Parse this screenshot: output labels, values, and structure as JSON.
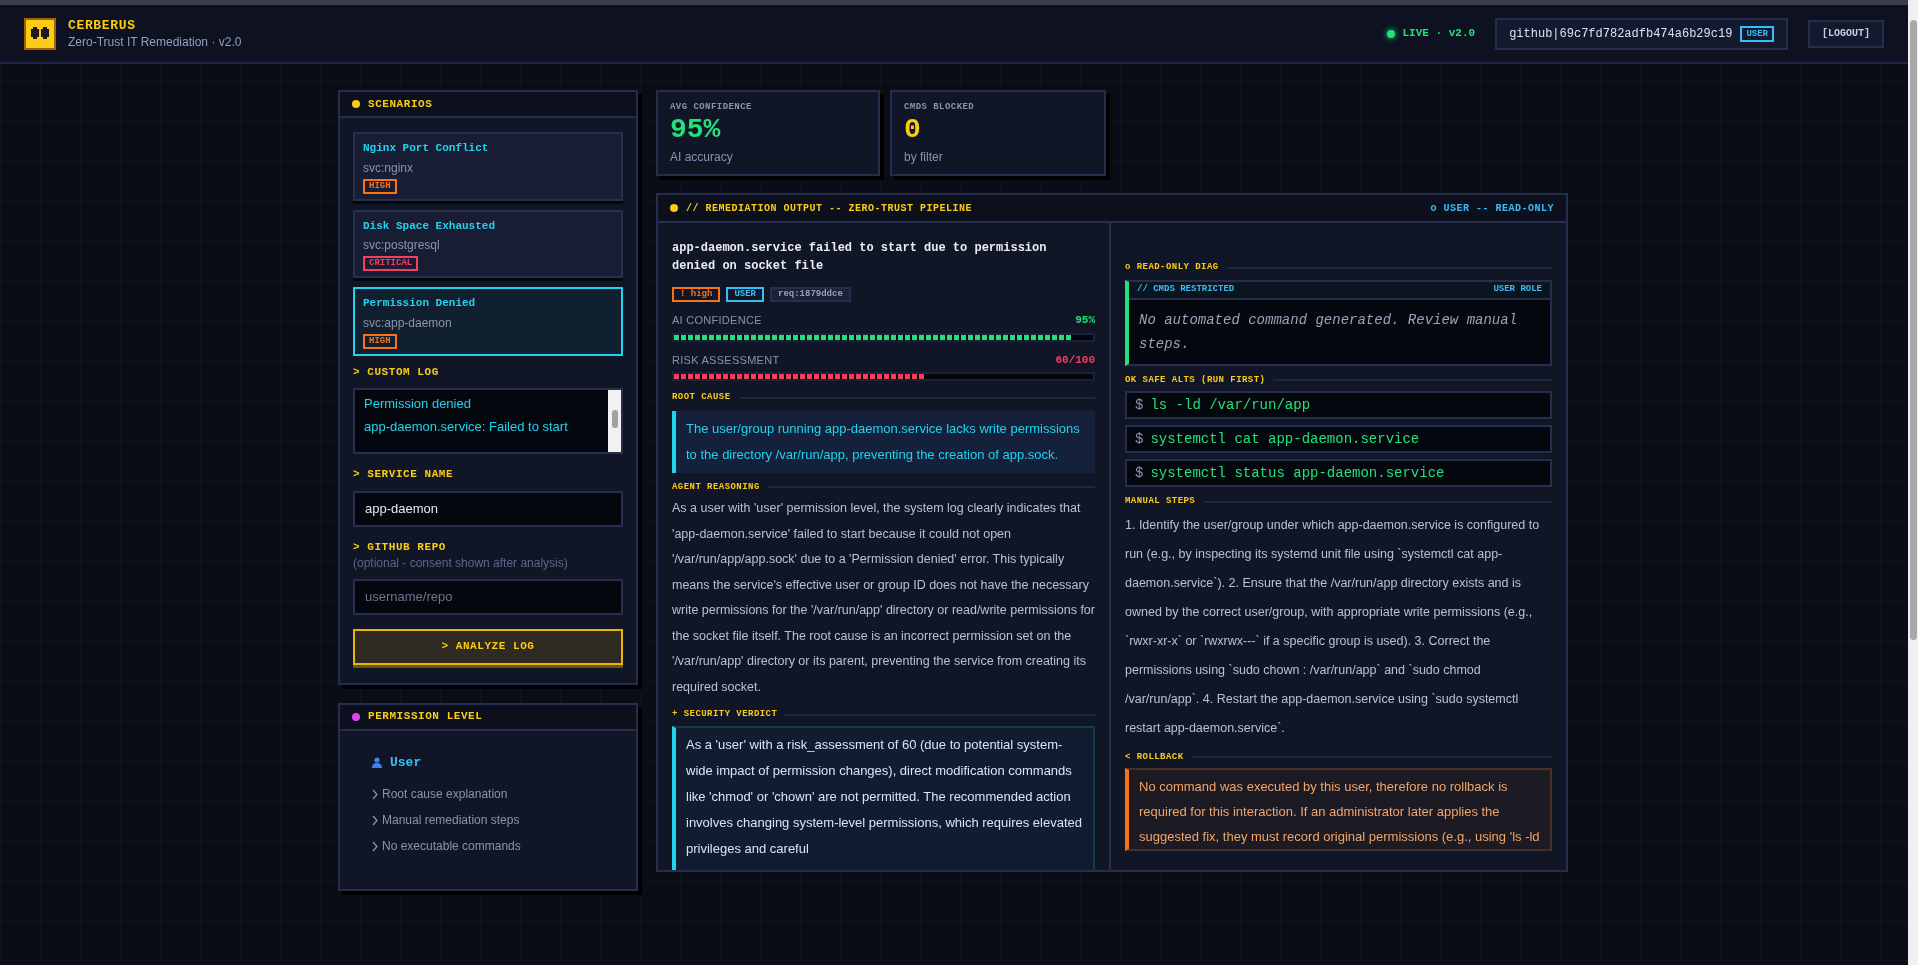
{
  "header": {
    "title": "CERBERUS",
    "subtitle": "Zero-Trust IT Remediation · v2.0",
    "status": {
      "label": "LIVE · v2.0",
      "live": true
    },
    "user": {
      "id": "github|69c7fd782adfb474a6b29c19",
      "role": "USER"
    },
    "logout": "[LOGOUT]"
  },
  "scenarios": {
    "title": "SCENARIOS",
    "items": [
      {
        "title": "Nginx Port Conflict",
        "service": "svc:nginx",
        "severity": "HIGH",
        "color": "#f97316",
        "selected": false
      },
      {
        "title": "Disk Space Exhausted",
        "service": "svc:postgresql",
        "severity": "CRITICAL",
        "color": "#f43f5e",
        "selected": false
      },
      {
        "title": "Permission Denied",
        "service": "svc:app-daemon",
        "severity": "HIGH",
        "color": "#f97316",
        "selected": true
      }
    ]
  },
  "custom_log": {
    "label": "> CUSTOM LOG",
    "lines": [
      "Permission denied",
      "app-daemon.service: Failed to start"
    ]
  },
  "service_name": {
    "label": "> SERVICE NAME",
    "value": "app-daemon"
  },
  "github_repo": {
    "label": "> GITHUB REPO",
    "hint": "(optional - consent shown after analysis)",
    "placeholder": "username/repo"
  },
  "analyze_button": "> ANALYZE LOG",
  "permission_level": {
    "title": "PERMISSION LEVEL",
    "role": "User",
    "items": [
      "Root cause explanation",
      "Manual remediation steps",
      "No executable commands"
    ]
  },
  "stats": [
    {
      "label": "AVG CONFIDENCE",
      "value": "95%",
      "caption": "AI accuracy",
      "color": "#22e07a"
    },
    {
      "label": "CMDS BLOCKED",
      "value": "0",
      "caption": "by filter",
      "color": "#facc15"
    }
  ],
  "remediation": {
    "title": "// REMEDIATION OUTPUT -- ZERO-TRUST PIPELINE",
    "mode": "o USER -- READ-ONLY",
    "summary": "app-daemon.service failed to start due to permission denied on socket file",
    "tags": [
      {
        "text": "! high",
        "color": "#f97316"
      },
      {
        "text": "USER",
        "color": "#38bdf8"
      },
      {
        "text": "req:1879ddce",
        "color": "#94a3b8"
      }
    ],
    "meters": [
      {
        "label": "AI CONFIDENCE",
        "reading": "95%",
        "level": 0.95,
        "color": "#22e07a"
      },
      {
        "label": "RISK ASSESSMENT",
        "reading": "60/100",
        "level": 0.6,
        "color": "#f43f5e"
      }
    ],
    "root_cause": {
      "label": "ROOT CAUSE",
      "text": "The user/group running app-daemon.service lacks write permissions to the directory /var/run/app, preventing the creation of app.sock."
    },
    "reasoning": {
      "label": "AGENT REASONING",
      "text": "As a user with 'user' permission level, the system log clearly indicates that 'app-daemon.service' failed to start because it could not open '/var/run/app/app.sock' due to a 'Permission denied' error. This typically means the service's effective user or group ID does not have the necessary write permissions for the '/var/run/app' directory or read/write permissions for the socket file itself. The root cause is an incorrect permission set on the '/var/run/app' directory or its parent, preventing the service from creating its required socket."
    },
    "verdict": {
      "label": "+ SECURITY VERDICT",
      "text": "As a 'user' with a risk_assessment of 60 (due to potential system-wide impact of permission changes), direct modification commands like 'chmod' or 'chown' are not permitted. The recommended action involves changing system-level permissions, which requires elevated privileges and careful"
    },
    "diag": {
      "label": "o READ-ONLY DIAG",
      "header": "// CMDS RESTRICTED",
      "role": "USER ROLE",
      "message": "No automated command generated. Review manual steps."
    },
    "safe_alts": {
      "label": "OK SAFE ALTS (RUN FIRST)",
      "commands": [
        {
          "prompt": "$",
          "command": "ls -ld /var/run/app"
        },
        {
          "prompt": "$",
          "command": "systemctl cat app-daemon.service"
        },
        {
          "prompt": "$",
          "command": "systemctl status app-daemon.service"
        }
      ]
    },
    "manual_steps": {
      "label": "MANUAL STEPS",
      "text": "1. Identify the user/group under which app-daemon.service is configured to run (e.g., by inspecting its systemd unit file using `systemctl cat app-daemon.service`). 2. Ensure that the /var/run/app directory exists and is owned by the correct user/group, with appropriate write permissions (e.g., `rwxr-xr-x` or `rwxrwx---` if a specific group is used). 3. Correct the permissions using `sudo chown : /var/run/app` and `sudo chmod /var/run/app`. 4. Restart the app-daemon.service using `sudo systemctl restart app-daemon.service`."
    },
    "rollback": {
      "label": "< ROLLBACK",
      "text": "No command was executed by this user, therefore no rollback is required for this interaction. If an administrator later applies the suggested fix, they must record original permissions (e.g., using 'ls -ld"
    }
  }
}
